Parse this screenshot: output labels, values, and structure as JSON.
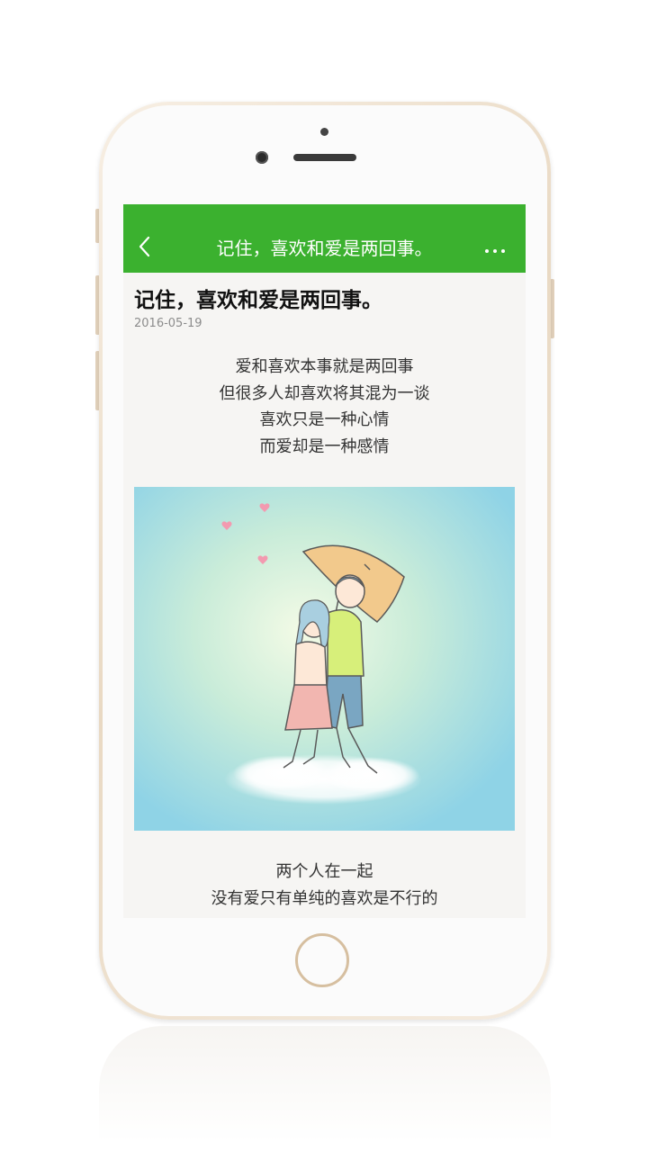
{
  "navbar": {
    "back_icon": "chevron-left-icon",
    "title": "记住，喜欢和爱是两回事。",
    "more_label": "···",
    "color": "#3bb12f"
  },
  "article": {
    "title": "记住，喜欢和爱是两回事。",
    "date": "2016-05-19",
    "paragraph_1": [
      "爱和喜欢本事就是两回事",
      "但很多人却喜欢将其混为一谈",
      "喜欢只是一种心情",
      "而爱却是一种感情"
    ],
    "image": "couple-under-umbrella-illustration",
    "paragraph_2": [
      "两个人在一起",
      "没有爱只有单纯的喜欢是不行的"
    ]
  }
}
